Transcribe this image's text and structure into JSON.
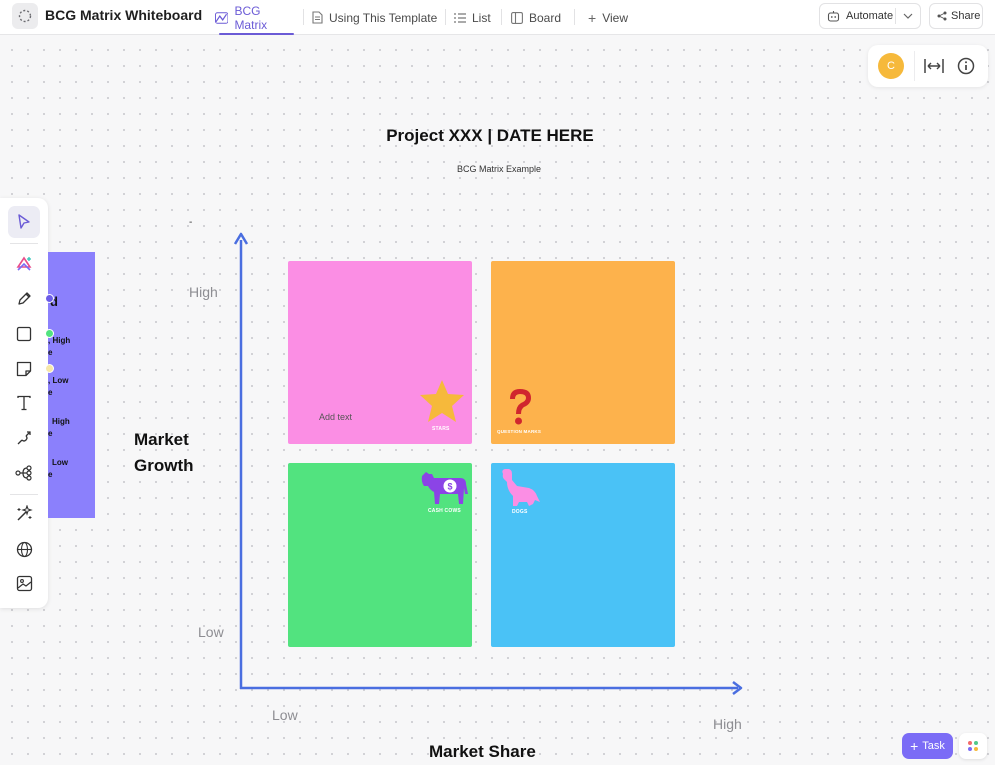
{
  "window": {
    "board_title": "BCG Matrix Whiteboard"
  },
  "tabs": [
    {
      "label": "BCG Matrix",
      "icon": "whiteboard-icon",
      "active": true
    },
    {
      "label": "Using This Template",
      "icon": "doc-icon",
      "active": false
    },
    {
      "label": "List",
      "icon": "list-icon",
      "active": false
    },
    {
      "label": "Board",
      "icon": "board-icon",
      "active": false
    }
  ],
  "add_view_label": "View",
  "header_actions": {
    "automate_label": "Automate",
    "share_label": "Share"
  },
  "user": {
    "avatar_initial": "C",
    "avatar_color": "#f6b93b"
  },
  "canvas": {
    "title": "Project XXX | DATE HERE",
    "subtitle": "BCG Matrix Example",
    "stray_mark": "-",
    "axis": {
      "y_title_line1": "Market",
      "y_title_line2": "Growth",
      "y_high": "High",
      "y_low": "Low",
      "x_title": "Market Share",
      "x_low": "Low",
      "x_high": "High",
      "color": "#4a6ee0"
    },
    "quadrants": [
      {
        "name": "stars",
        "label": "STARS",
        "color": "#fb8ee4",
        "placeholder": "Add text"
      },
      {
        "name": "question-marks",
        "label": "QUESTION MARKS",
        "color": "#fdb24c"
      },
      {
        "name": "cash-cows",
        "label": "CASH COWS",
        "color": "#52e37f"
      },
      {
        "name": "dogs",
        "label": "DOGS",
        "color": "#4ac2f6"
      }
    ],
    "legend_card": {
      "color": "#8b80fc",
      "heading": "d",
      "items": [
        {
          "line1": ", High",
          "line2": "e",
          "dot_color": "#6c5ce7"
        },
        {
          "line1": ", Low",
          "line2": "e",
          "dot_color": "#52e37f"
        },
        {
          "line1": "High",
          "line2": "e",
          "dot_color": "#f6e7a8"
        },
        {
          "line1": "Low",
          "line2": "e",
          "dot_color": "#8b80fc"
        }
      ]
    }
  },
  "toolbar": {
    "tools": [
      "select-tool",
      "ai-shapes-tool",
      "pen-tool",
      "shape-tool",
      "sticky-note-tool",
      "text-tool",
      "connector-tool",
      "mind-map-tool",
      "magic-tool",
      "web-embed-tool",
      "image-tool"
    ]
  },
  "task_button": {
    "label": "Task"
  }
}
